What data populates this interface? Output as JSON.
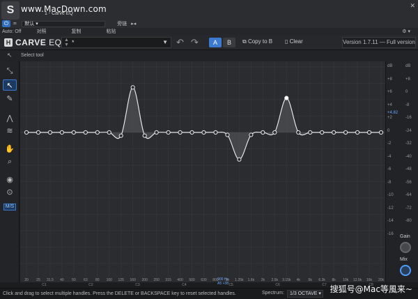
{
  "host": {
    "logo": "S",
    "watermark": "www.MacDown.com",
    "preset_name": "1 - Carve EQ",
    "preset_default": "默认",
    "bypass": "旁链",
    "auto_off": "Auto: Off",
    "compare": "对照",
    "copy": "复制",
    "paste": "粘贴"
  },
  "plugin": {
    "brand_bold": "CARVE",
    "brand_light": "EQ",
    "preset": "*",
    "a_label": "A",
    "b_label": "B",
    "copy_to_b": "Copy to B",
    "clear": "Clear",
    "version": "Version 1.7.11 — Full version"
  },
  "toolrow": {
    "hint": "Select tool"
  },
  "tools": {
    "items": [
      {
        "name": "pick-tool",
        "glyph": "↘"
      },
      {
        "name": "select-tool",
        "glyph": "↖",
        "active": true
      },
      {
        "name": "pencil-tool",
        "glyph": "✎"
      },
      {
        "name": "peak-tool",
        "glyph": "∧"
      },
      {
        "name": "smooth-tool",
        "glyph": "≈"
      },
      {
        "name": "hand-tool",
        "glyph": "✋"
      },
      {
        "name": "zoom-tool",
        "glyph": "⌕"
      }
    ],
    "ms_label": "M/S"
  },
  "meter": {
    "db_left": [
      "dB",
      "+8",
      "+6",
      "+4",
      "+2",
      "0",
      "-2",
      "-4",
      "-6",
      "-8",
      "-10",
      "-12",
      "-14",
      "-16"
    ],
    "db_right": [
      "dB",
      "+8",
      "0",
      "-8",
      "-16",
      "-24",
      "-32",
      "-40",
      "-48",
      "-56",
      "-64",
      "-72",
      "-80"
    ],
    "peak_readout": "+4.82",
    "gain_label": "Gain",
    "mix_label": "Mix"
  },
  "chart_data": {
    "type": "line",
    "x_ticks": [
      "20",
      "25",
      "31.5",
      "40",
      "50",
      "63",
      "80",
      "100",
      "125",
      "160",
      "200",
      "250",
      "315",
      "400",
      "500",
      "630",
      "800",
      "1k",
      "1.25k",
      "1.6k",
      "2k",
      "2.5k",
      "3.15k",
      "4k",
      "5k",
      "6.3k",
      "8k",
      "10k",
      "12.5k",
      "16k",
      "20k"
    ],
    "octaves": [
      "C1",
      "C2",
      "C3",
      "C4",
      "C5",
      "C6",
      "C7",
      "C8"
    ],
    "cursor_freq": "900 Hz",
    "cursor_note": "A5 +38",
    "ylim": [
      -16,
      8
    ],
    "series": [
      {
        "values": [
          0,
          0,
          0,
          0,
          0,
          0,
          0,
          0,
          -0.4,
          5.5,
          -0.4,
          0,
          0,
          0,
          0,
          0,
          0,
          -0.3,
          -3.3,
          -0.3,
          0,
          0,
          4.2,
          0,
          0,
          0,
          0,
          0,
          0,
          0,
          0
        ]
      }
    ]
  },
  "status": {
    "message": "Click and drag to select multiple handles. Press the DELETE or BACKSPACE key to reset selected handles.",
    "spectrum_label": "Spectrum:",
    "spectrum_value": "1/3 OCTAVE",
    "overlay_watermark": "搜狐号@Mac等風来~"
  },
  "colors": {
    "accent": "#3c7ad0",
    "curve": "#e6e6e6",
    "fill": "#505155",
    "graph_bg": "#2b2c2f"
  }
}
